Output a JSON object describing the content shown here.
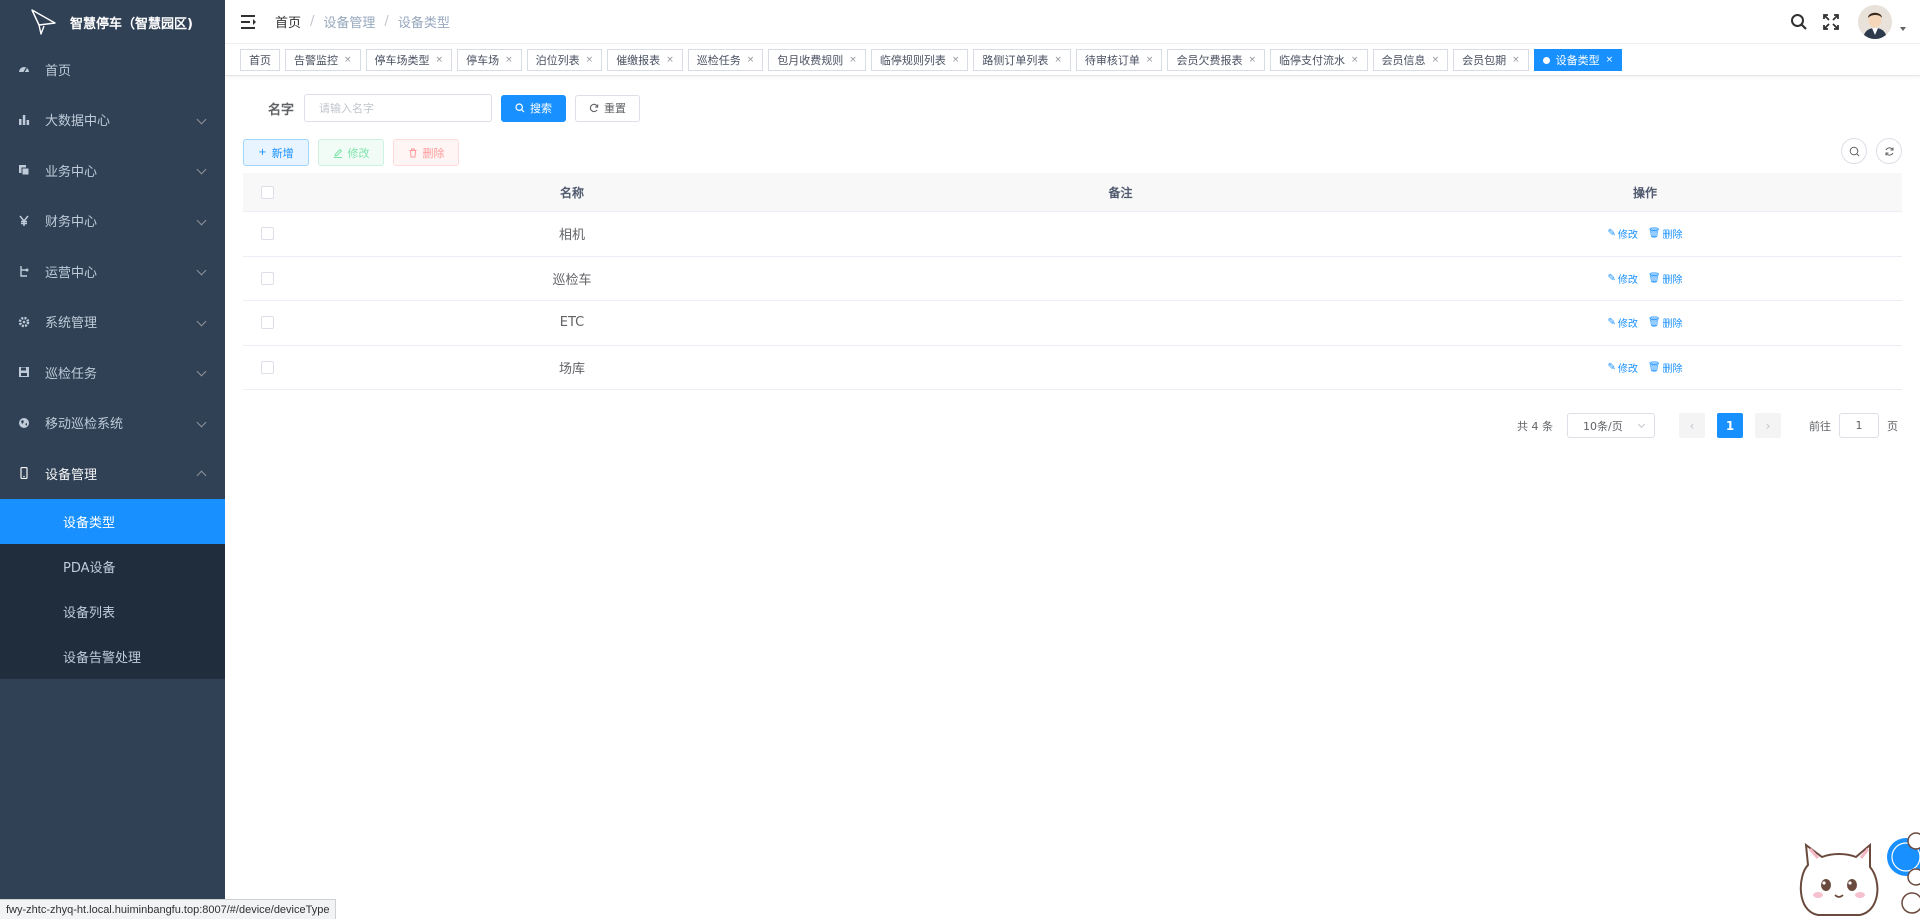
{
  "app": {
    "title": "智慧停车（智慧园区)"
  },
  "sidebar": {
    "items": [
      {
        "label": "首页",
        "icon": "dashboard-icon"
      },
      {
        "label": "大数据中心",
        "icon": "bar-chart-icon"
      },
      {
        "label": "业务中心",
        "icon": "documents-icon"
      },
      {
        "label": "财务中心",
        "icon": "yen-icon"
      },
      {
        "label": "运营中心",
        "icon": "operations-icon"
      },
      {
        "label": "系统管理",
        "icon": "gear-icon"
      },
      {
        "label": "巡检任务",
        "icon": "save-icon"
      },
      {
        "label": "移动巡检系统",
        "icon": "globe-icon"
      },
      {
        "label": "设备管理",
        "icon": "mobile-icon"
      }
    ],
    "submenu": [
      {
        "label": "设备类型"
      },
      {
        "label": "PDA设备"
      },
      {
        "label": "设备列表"
      },
      {
        "label": "设备告警处理"
      }
    ],
    "bg_color": "#304156",
    "active_color": "#1890ff"
  },
  "breadcrumb": {
    "home": "首页",
    "level1": "设备管理",
    "level2": "设备类型"
  },
  "tags": [
    {
      "label": "首页",
      "closable": false
    },
    {
      "label": "告警监控",
      "closable": true
    },
    {
      "label": "停车场类型",
      "closable": true
    },
    {
      "label": "停车场",
      "closable": true
    },
    {
      "label": "泊位列表",
      "closable": true
    },
    {
      "label": "催缴报表",
      "closable": true
    },
    {
      "label": "巡检任务",
      "closable": true
    },
    {
      "label": "包月收费规则",
      "closable": true
    },
    {
      "label": "临停规则列表",
      "closable": true
    },
    {
      "label": "路侧订单列表",
      "closable": true
    },
    {
      "label": "待审核订单",
      "closable": true
    },
    {
      "label": "会员欠费报表",
      "closable": true
    },
    {
      "label": "临停支付流水",
      "closable": true
    },
    {
      "label": "会员信息",
      "closable": true
    },
    {
      "label": "会员包期",
      "closable": true
    },
    {
      "label": "设备类型",
      "closable": true,
      "active": true
    }
  ],
  "search": {
    "label": "名字",
    "placeholder": "请输入名字",
    "search_btn": "搜索",
    "reset_btn": "重置"
  },
  "toolbar": {
    "add": "新增",
    "edit": "修改",
    "delete": "删除"
  },
  "table": {
    "headers": {
      "name": "名称",
      "note": "备注",
      "ops": "操作"
    },
    "rows": [
      {
        "name": "相机",
        "note": ""
      },
      {
        "name": "巡检车",
        "note": ""
      },
      {
        "name": "ETC",
        "note": ""
      },
      {
        "name": "场库",
        "note": ""
      }
    ],
    "op_edit": "修改",
    "op_delete": "删除"
  },
  "pagination": {
    "total": "共 4 条",
    "page_size": "10条/页",
    "current": "1",
    "goto_label": "前往",
    "goto_value": "1",
    "page_suffix": "页"
  },
  "status_url": "fwy-zhtc-zhyq-ht.local.huiminbangfu.top:8007/#/device/deviceType",
  "colors": {
    "primary": "#1890ff",
    "success": "#13ce66",
    "danger": "#ff4949"
  }
}
